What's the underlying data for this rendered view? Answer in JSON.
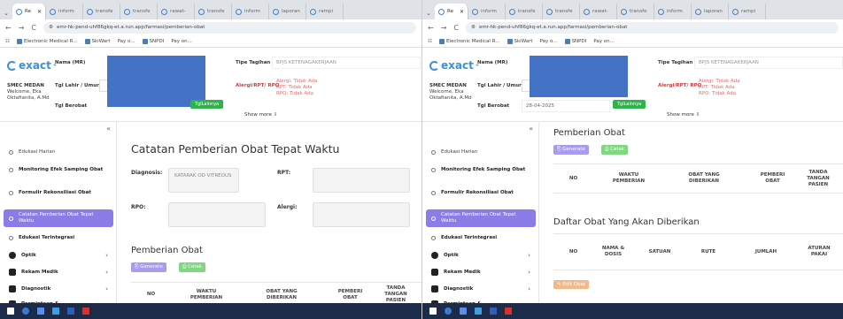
{
  "browser": {
    "tabs": [
      "Re",
      "inform",
      "transfe",
      "transfe",
      "rawat-",
      "transfe",
      "inform",
      "laporan",
      "rampi",
      "lengka"
    ],
    "url": "emr-hk-pend-uhf86gkq-et.a.run.app/farmasi/pemberian-obat",
    "bookmarks": [
      "Electronic Medical R...",
      "SkiWart",
      "Pay o...",
      "SNPDI",
      "Pay on..."
    ]
  },
  "header": {
    "logo_text": "exact",
    "hospital": "SMEC MEDAN",
    "welcome": "Welcome, Eka Oktafianita, A.Md",
    "labels": {
      "mr": "Nama (MR)",
      "dob": "Tgl Lahir / Umur",
      "visit": "Tgl Berobat",
      "billing": "Tipe Tagihan",
      "allergy": "Alergi/RPT/ RPO"
    },
    "billing_value": "BPJS KETENAGAKERJAAN",
    "visit_value_right": "28-04-2025",
    "allergy_lines": [
      "Alergi: Tidak Ada",
      "RPT: Tidak Ada",
      "RPO: Tidak Ada"
    ],
    "green_btn": "TglLainnya",
    "show_more": "Show more ⇩"
  },
  "sidebar": {
    "items": [
      {
        "label": "Edukasi Harian"
      },
      {
        "label": "Monitoring Efek Samping Obat"
      },
      {
        "label": "Formulir Rekonsiliasi Obat"
      },
      {
        "label": "Catatan Pemberian Obat Tepat Waktu"
      },
      {
        "label": "Edukasi Terintegrasi"
      },
      {
        "label": "Optik"
      },
      {
        "label": "Rekam Medik"
      },
      {
        "label": "Diagnostik"
      },
      {
        "label": "Permintaan &"
      }
    ]
  },
  "left_main": {
    "title": "Catatan Pemberian Obat Tepat Waktu",
    "diagnosis_label": "Diagnosis:",
    "diagnosis_value": "KATARAK OD VITREOUS",
    "rpt_label": "RPT:",
    "rpo_label": "RPO:",
    "alergi_label": "Alergi:",
    "section": "Pemberian Obat",
    "generate": "⎘ Generate",
    "cetak": "⎙ Cetak",
    "cols": [
      "NO",
      "WAKTU PEMBERIAN",
      "OBAT YANG DIBERIKAN",
      "PEMBERI OBAT",
      "TANDA TANGAN PASIEN"
    ]
  },
  "right_main": {
    "section": "Pemberian Obat",
    "generate": "⎘ Generate",
    "cetak": "⎙ Cetak",
    "cols": [
      "NO",
      "WAKTU PEMBERIAN",
      "OBAT YANG DIBERIKAN",
      "PEMBERI OBAT",
      "TANDA TANGAN PASIEN"
    ],
    "section2": "Daftar Obat Yang Akan Diberikan",
    "cols2": [
      "NO",
      "NAMA & DOSIS",
      "SATUAN",
      "RUTE",
      "JUMLAH",
      "ATURAN PAKAI"
    ],
    "edit": "✎ Edit Obat"
  }
}
